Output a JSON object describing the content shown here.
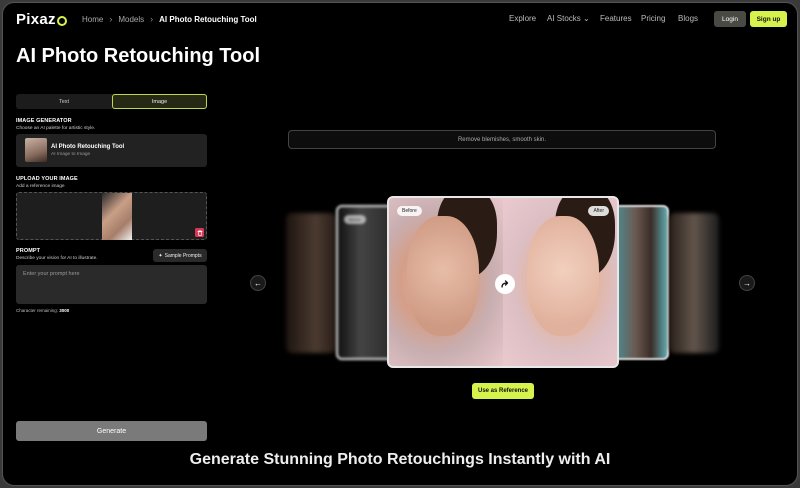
{
  "nav": {
    "logo": "Pixaz",
    "breadcrumbs": [
      "Home",
      "Models",
      "AI Photo Retouching Tool"
    ],
    "menu": [
      "Explore",
      "AI Stocks",
      "Features",
      "Pricing",
      "Blogs"
    ],
    "login": "Login",
    "signup": "Sign up"
  },
  "page_title": "AI Photo Retouching Tool",
  "tabs": {
    "text": "Text",
    "image": "Image",
    "active": "Image"
  },
  "generator": {
    "title": "IMAGE GENERATOR",
    "subtitle": "Choose an AI palette for artistic style.",
    "model_name": "AI Photo Retouching Tool",
    "model_sub": "AI Image to Image"
  },
  "upload": {
    "title": "UPLOAD YOUR IMAGE",
    "subtitle": "Add a reference image"
  },
  "prompt": {
    "title": "PROMPT",
    "subtitle": "Describe your vision for AI to illustrate.",
    "sample_button": "Sample Prompts",
    "placeholder": "Enter your prompt here",
    "char_label": "Character remaining:",
    "char_count": "3000"
  },
  "generate_label": "Generate",
  "preview": {
    "prompt_text": "Remove blemishes, smooth skin.",
    "before_label": "Before",
    "after_label": "After",
    "side_left_label": "Before",
    "use_reference": "Use as Reference"
  },
  "bottom_title": "Generate Stunning Photo Retouchings Instantly with AI",
  "colors": {
    "accent": "#d6f24c",
    "danger": "#d93556",
    "background": "#000000"
  },
  "icons": [
    "chevron-right-icon",
    "chevron-down-icon",
    "trash-icon",
    "sparkle-icon",
    "swap-arrow-icon",
    "arrow-left-icon",
    "arrow-right-icon"
  ]
}
